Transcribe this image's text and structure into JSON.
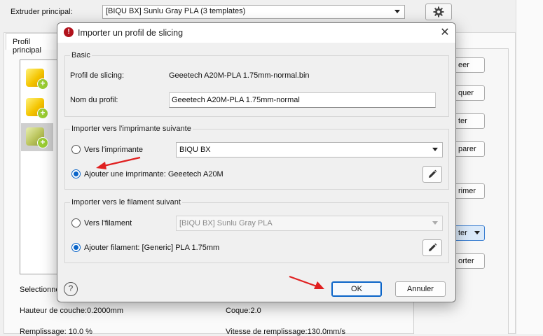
{
  "background": {
    "extruder_label": "Extruder principal:",
    "extruder_value": "[BIQU BX] Sunlu Gray PLA (3 templates)",
    "tab_label": "Profil principal",
    "right_buttons": [
      "eer",
      "quer",
      "ter",
      "parer",
      "rimer",
      "ter",
      "orter"
    ],
    "info": {
      "selected_label": "Selectionne",
      "layer_height": "Hauteur de couche:0.2000mm",
      "shell": "Coque:2.0",
      "infill": "Remplissage: 10.0 %",
      "infill_speed": "Vitesse de remplissage:130.0mm/s"
    }
  },
  "dialog": {
    "title": "Importer un profil de slicing",
    "basic": {
      "group_title": "Basic",
      "profile_label": "Profil de slicing:",
      "profile_value": "Geeetech A20M-PLA 1.75mm-normal.bin",
      "name_label": "Nom du profil:",
      "name_value": "Geeetech A20M-PLA 1.75mm-normal"
    },
    "printer": {
      "group_title": "Importer vers l'imprimante suivante",
      "option_existing": "Vers l'imprimante",
      "existing_value": "BIQU BX",
      "option_add": "Ajouter une imprimante: Geeetech A20M",
      "selected": "add"
    },
    "filament": {
      "group_title": "Importer vers le filament suivant",
      "option_existing": "Vers l'filament",
      "existing_value": "[BIQU BX] Sunlu Gray PLA",
      "option_add": "Ajouter filament: [Generic] PLA 1.75mm",
      "selected": "add"
    },
    "buttons": {
      "ok": "OK",
      "cancel": "Annuler"
    }
  },
  "colors": {
    "accent": "#0a64c8",
    "annotation_arrow": "#e02020"
  }
}
